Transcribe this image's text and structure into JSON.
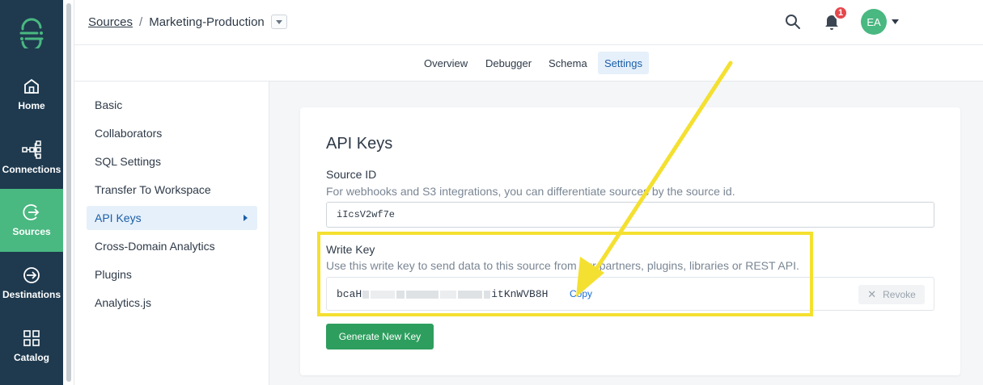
{
  "nav": {
    "items": [
      {
        "label": "Home",
        "icon": "home-icon"
      },
      {
        "label": "Connections",
        "icon": "connections-icon"
      },
      {
        "label": "Sources",
        "icon": "sources-icon"
      },
      {
        "label": "Destinations",
        "icon": "destinations-icon"
      },
      {
        "label": "Catalog",
        "icon": "catalog-icon"
      }
    ],
    "active": "Sources"
  },
  "header": {
    "breadcrumb_root": "Sources",
    "breadcrumb_sep": "/",
    "breadcrumb_current": "Marketing-Production",
    "notification_count": "1",
    "avatar_initials": "EA"
  },
  "tabs": [
    "Overview",
    "Debugger",
    "Schema",
    "Settings"
  ],
  "active_tab": "Settings",
  "settings_menu": {
    "items": [
      "Basic",
      "Collaborators",
      "SQL Settings",
      "Transfer To Workspace",
      "API Keys",
      "Cross-Domain Analytics",
      "Plugins",
      "Analytics.js"
    ],
    "active": "API Keys"
  },
  "api_keys": {
    "title": "API Keys",
    "source_id_label": "Source ID",
    "source_id_desc": "For webhooks and S3 integrations, you can differentiate sources by the source id.",
    "source_id_value": "iIcsV2wf7e",
    "write_key_label": "Write Key",
    "write_key_desc": "Use this write key to send data to this source from our partners, plugins, libraries or REST API.",
    "write_key_prefix": "bcaH",
    "write_key_suffix": "itKnWVB8H",
    "copy_label": "Copy",
    "revoke_label": "Revoke",
    "generate_label": "Generate New Key"
  },
  "colors": {
    "nav_bg": "#1f3a4f",
    "nav_active": "#49b881",
    "accent_blue": "#1a6ed8",
    "primary_green": "#2e9e5e",
    "annotation_yellow": "#f4e030"
  }
}
